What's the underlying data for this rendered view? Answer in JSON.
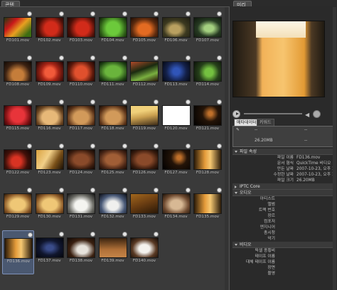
{
  "panels": {
    "left_tab": "콘텐트",
    "right_tab": "미리보기"
  },
  "thumbnails": [
    {
      "name": "FD101.mov",
      "style": "t-pepper"
    },
    {
      "name": "FD102.mov",
      "style": "t-redpep"
    },
    {
      "name": "FD103.mov",
      "style": "t-redpep"
    },
    {
      "name": "FD104.mov",
      "style": "t-grnpep"
    },
    {
      "name": "FD105.mov",
      "style": "t-carrot"
    },
    {
      "name": "FD106.mov",
      "style": "t-lime"
    },
    {
      "name": "FD107.mov",
      "style": "t-cucumber"
    },
    {
      "name": "FD108.mov",
      "style": "t-bread"
    },
    {
      "name": "FD109.mov",
      "style": "t-tomslice"
    },
    {
      "name": "FD110.mov",
      "style": "t-tomato"
    },
    {
      "name": "FD111.mov",
      "style": "t-lettuce"
    },
    {
      "name": "FD112.mov",
      "style": "t-mixed"
    },
    {
      "name": "FD113.mov",
      "style": "t-blue"
    },
    {
      "name": "FD114.mov",
      "style": "t-greenball"
    },
    {
      "name": "FD115.mov",
      "style": "t-straw"
    },
    {
      "name": "FD116.mov",
      "style": "t-pancake"
    },
    {
      "name": "FD117.mov",
      "style": "t-pancake2"
    },
    {
      "name": "FD118.mov",
      "style": "t-pancake2"
    },
    {
      "name": "FD119.mov",
      "style": "t-cake"
    },
    {
      "name": "FD120.mov",
      "style": "t-white"
    },
    {
      "name": "FD121.mov",
      "style": "t-dark"
    },
    {
      "name": "FD122.mov",
      "style": "t-redsmall"
    },
    {
      "name": "FD123.mov",
      "style": "t-fries"
    },
    {
      "name": "FD124.mov",
      "style": "t-burger"
    },
    {
      "name": "FD125.mov",
      "style": "t-burger2"
    },
    {
      "name": "FD126.mov",
      "style": "t-burger"
    },
    {
      "name": "FD127.mov",
      "style": "t-dark"
    },
    {
      "name": "FD128.mov",
      "style": "t-glass"
    },
    {
      "name": "FD129.mov",
      "style": "t-pie"
    },
    {
      "name": "FD130.mov",
      "style": "t-pie"
    },
    {
      "name": "FD131.mov",
      "style": "t-cream"
    },
    {
      "name": "FD132.mov",
      "style": "t-creamblue"
    },
    {
      "name": "FD133.mov",
      "style": "t-brown"
    },
    {
      "name": "FD134.mov",
      "style": "t-rose"
    },
    {
      "name": "FD135.mov",
      "style": "t-glass"
    },
    {
      "name": "FD136.mov",
      "style": "t-glass",
      "selected": true
    },
    {
      "name": "FD137.mov",
      "style": "t-blueblack"
    },
    {
      "name": "FD138.mov",
      "style": "t-coffee"
    },
    {
      "name": "FD139.mov",
      "style": "t-wood"
    },
    {
      "name": "FD140.mov",
      "style": "t-cup"
    }
  ],
  "transport": {
    "volume_icon": "◀"
  },
  "meta_tabs": [
    "메타데이터",
    "키워드"
  ],
  "meta_block": {
    "size": "26.20MB",
    "dash1": "--",
    "dash2": "--"
  },
  "sections": {
    "file_props": "파일 속성",
    "iptc": "IPTC Core",
    "audio": "오디오",
    "video": "비디오"
  },
  "file_props": [
    {
      "key": "파일 이름",
      "value": "FD136.mov"
    },
    {
      "key": "문서 형식",
      "value": "QuickTime 비디오"
    },
    {
      "key": "만든 날짜",
      "value": "2007-10-23, 오후 11:4"
    },
    {
      "key": "수정한 날짜",
      "value": "2007-10-23, 오후 11:4"
    },
    {
      "key": "파일 크기",
      "value": "26.20MB"
    }
  ],
  "audio_props": [
    "아티스트",
    "앨범",
    "트랙 번호",
    "장르",
    "컴포저",
    "엔지니어",
    "총시청",
    "악기"
  ],
  "video_props": [
    "픽셀 종횡비",
    "테이프 이름",
    "대체 테이프 이름",
    "장면",
    "촬영"
  ]
}
